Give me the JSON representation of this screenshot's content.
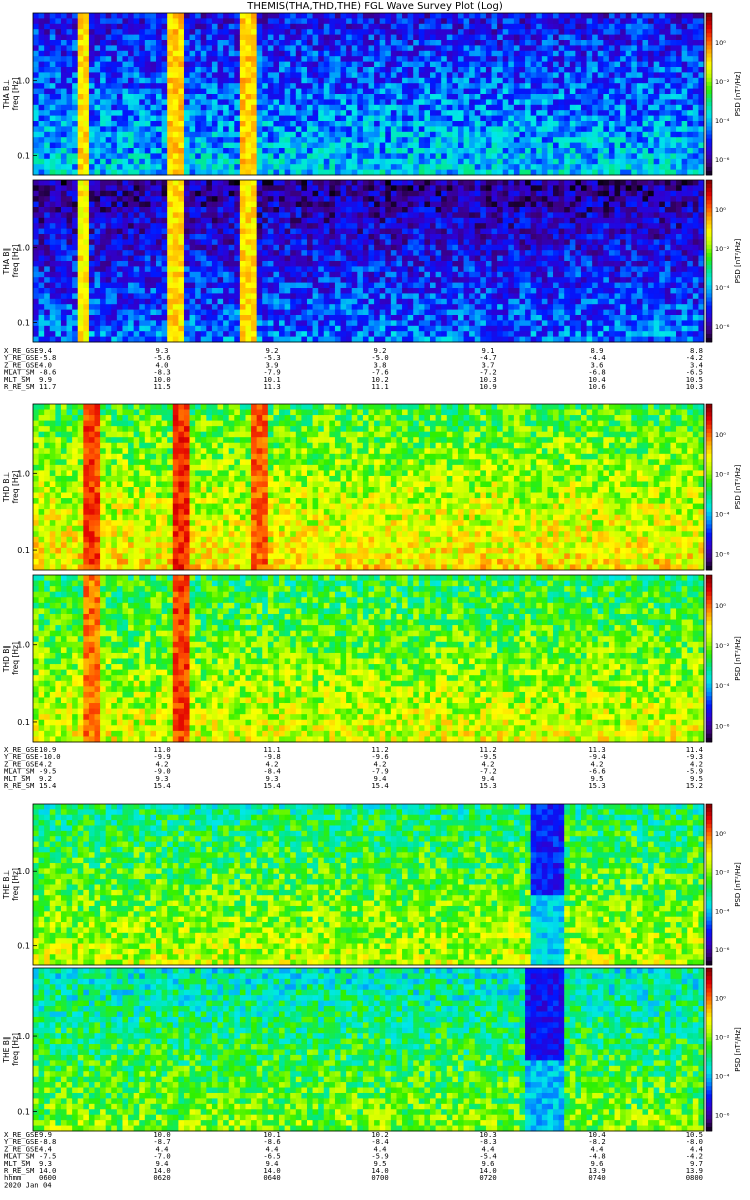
{
  "title": "THEMIS(THA,THD,THE) FGL Wave Survey Plot (Log)",
  "colorbar": {
    "label": "PSD [nT²/Hz]",
    "ticks": [
      "10⁰",
      "10⁻²",
      "10⁻⁴",
      "10⁻⁶"
    ],
    "colors": [
      "#000000",
      "#3c0078",
      "#3000d0",
      "#0018ff",
      "#0090ff",
      "#00e8e8",
      "#00e888",
      "#30f000",
      "#b8ff00",
      "#ffff00",
      "#ffb000",
      "#ff5000",
      "#e00000",
      "#880000"
    ]
  },
  "chart_data": [
    {
      "type": "heatmap",
      "ylabel": "THA B⊥\nfreq [Hz]",
      "yticks": [
        "1.0",
        "0.1"
      ],
      "ylim": [
        0.055,
        8
      ],
      "yscale": "log",
      "zscale": "log",
      "zticks": [
        "10⁰",
        "10⁻²",
        "10⁻⁴",
        "10⁻⁶"
      ],
      "zlabel": "PSD [nT²/Hz]",
      "x_range": [
        "06:00",
        "08:00"
      ],
      "base_level": 0.28,
      "bursts": [
        {
          "start": "06:08",
          "end": "06:10",
          "level": 0.72
        },
        {
          "start": "06:24",
          "end": "06:27",
          "level": 0.74
        },
        {
          "start": "06:37",
          "end": "06:40",
          "level": 0.74
        }
      ]
    },
    {
      "type": "heatmap",
      "ylabel": "THA B∥\nfreq [Hz]",
      "yticks": [
        "1.0",
        "0.1"
      ],
      "ylim": [
        0.055,
        8
      ],
      "yscale": "log",
      "zscale": "log",
      "zticks": [
        "10⁰",
        "10⁻²",
        "10⁻⁴",
        "10⁻⁶"
      ],
      "zlabel": "PSD [nT²/Hz]",
      "x_range": [
        "06:00",
        "08:00"
      ],
      "base_level": 0.2,
      "bursts": [
        {
          "start": "06:08",
          "end": "06:10",
          "level": 0.7
        },
        {
          "start": "06:24",
          "end": "06:27",
          "level": 0.72
        },
        {
          "start": "06:37",
          "end": "06:40",
          "level": 0.72
        }
      ]
    },
    {
      "type": "heatmap",
      "ylabel": "THD B⊥\nfreq [Hz]",
      "yticks": [
        "1.0",
        "0.1"
      ],
      "ylim": [
        0.055,
        8
      ],
      "yscale": "log",
      "zscale": "log",
      "zticks": [
        "10⁰",
        "10⁻²",
        "10⁻⁴",
        "10⁻⁶"
      ],
      "zlabel": "PSD [nT²/Hz]",
      "x_range": [
        "06:00",
        "08:00"
      ],
      "base_level": 0.62,
      "bursts": [
        {
          "start": "06:09",
          "end": "06:12",
          "level": 0.86
        },
        {
          "start": "06:25",
          "end": "06:28",
          "level": 0.88
        },
        {
          "start": "06:39",
          "end": "06:42",
          "level": 0.84
        }
      ]
    },
    {
      "type": "heatmap",
      "ylabel": "THD B∥\nfreq [Hz]",
      "yticks": [
        "1.0",
        "0.1"
      ],
      "ylim": [
        0.055,
        8
      ],
      "yscale": "log",
      "zscale": "log",
      "zticks": [
        "10⁰",
        "10⁻²",
        "10⁻⁴",
        "10⁻⁶"
      ],
      "zlabel": "PSD [nT²/Hz]",
      "x_range": [
        "06:00",
        "08:00"
      ],
      "base_level": 0.58,
      "bursts": [
        {
          "start": "06:09",
          "end": "06:12",
          "level": 0.82
        },
        {
          "start": "06:25",
          "end": "06:28",
          "level": 0.86
        }
      ]
    },
    {
      "type": "heatmap",
      "ylabel": "THE B⊥\nfreq [Hz]",
      "yticks": [
        "1.0",
        "0.1"
      ],
      "ylim": [
        0.055,
        8
      ],
      "yscale": "log",
      "zscale": "log",
      "zticks": [
        "10⁰",
        "10⁻²",
        "10⁻⁴",
        "10⁻⁶"
      ],
      "zlabel": "PSD [nT²/Hz]",
      "x_range": [
        "06:00",
        "08:00"
      ],
      "base_level": 0.55,
      "quiet": [
        {
          "start": "07:29",
          "end": "07:35",
          "level": 0.22
        }
      ]
    },
    {
      "type": "heatmap",
      "ylabel": "THE B∥\nfreq [Hz]",
      "yticks": [
        "1.0",
        "0.1"
      ],
      "ylim": [
        0.055,
        8
      ],
      "yscale": "log",
      "zscale": "log",
      "zticks": [
        "10⁰",
        "10⁻²",
        "10⁻⁴",
        "10⁻⁶"
      ],
      "zlabel": "PSD [nT²/Hz]",
      "x_range": [
        "06:00",
        "08:00"
      ],
      "base_level": 0.5,
      "quiet": [
        {
          "start": "07:28",
          "end": "07:35",
          "level": 0.2
        }
      ]
    }
  ],
  "ephemeris": [
    {
      "labels": [
        "X_RE_GSE",
        "Y_RE_GSE",
        "Z_RE_GSE",
        "MLAT_SM",
        "MLT_SM",
        "R_RE_SM"
      ],
      "rows": [
        [
          "9.4",
          "9.3",
          "9.2",
          "9.2",
          "9.1",
          "8.9",
          "8.8"
        ],
        [
          "-5.8",
          "-5.6",
          "-5.3",
          "-5.0",
          "-4.7",
          "-4.4",
          "-4.2"
        ],
        [
          "4.0",
          "4.0",
          "3.9",
          "3.8",
          "3.7",
          "3.6",
          "3.4"
        ],
        [
          "-8.6",
          "-8.3",
          "-7.9",
          "-7.6",
          "-7.2",
          "-6.8",
          "-6.5"
        ],
        [
          "9.9",
          "10.0",
          "10.1",
          "10.2",
          "10.3",
          "10.4",
          "10.5"
        ],
        [
          "11.7",
          "11.5",
          "11.3",
          "11.1",
          "10.9",
          "10.6",
          "10.3"
        ]
      ]
    },
    {
      "labels": [
        "X_RE_GSE",
        "Y_RE_GSE",
        "Z_RE_GSE",
        "MLAT_SM",
        "MLT_SM",
        "R_RE_SM"
      ],
      "rows": [
        [
          "10.9",
          "11.0",
          "11.1",
          "11.2",
          "11.2",
          "11.3",
          "11.4"
        ],
        [
          "-10.0",
          "-9.9",
          "-9.8",
          "-9.6",
          "-9.5",
          "-9.4",
          "-9.3"
        ],
        [
          "4.2",
          "4.2",
          "4.2",
          "4.2",
          "4.2",
          "4.2",
          "4.2"
        ],
        [
          "-9.5",
          "-9.0",
          "-8.4",
          "-7.9",
          "-7.2",
          "-6.6",
          "-5.9"
        ],
        [
          "9.2",
          "9.3",
          "9.3",
          "9.4",
          "9.4",
          "9.5",
          "9.5"
        ],
        [
          "15.4",
          "15.4",
          "15.4",
          "15.4",
          "15.3",
          "15.3",
          "15.2"
        ]
      ]
    },
    {
      "labels": [
        "X_RE_GSE",
        "Y_RE_GSE",
        "Z_RE_GSE",
        "MLAT_SM",
        "MLT_SM",
        "R_RE_SM",
        "hhmm",
        "2020 Jan 04"
      ],
      "rows": [
        [
          "9.9",
          "10.0",
          "10.1",
          "10.2",
          "10.3",
          "10.4",
          "10.5"
        ],
        [
          "-8.8",
          "-8.7",
          "-8.6",
          "-8.4",
          "-8.3",
          "-8.2",
          "-8.0"
        ],
        [
          "4.4",
          "4.4",
          "4.4",
          "4.4",
          "4.4",
          "4.4",
          "4.4"
        ],
        [
          "-7.5",
          "-7.0",
          "-6.5",
          "-5.9",
          "-5.4",
          "-4.8",
          "-4.2"
        ],
        [
          "9.3",
          "9.4",
          "9.4",
          "9.5",
          "9.6",
          "9.6",
          "9.7"
        ],
        [
          "14.0",
          "14.0",
          "14.0",
          "14.0",
          "14.0",
          "13.9",
          "13.9"
        ],
        [
          "0600",
          "0620",
          "0640",
          "0700",
          "0720",
          "0740",
          "0800"
        ]
      ]
    }
  ]
}
